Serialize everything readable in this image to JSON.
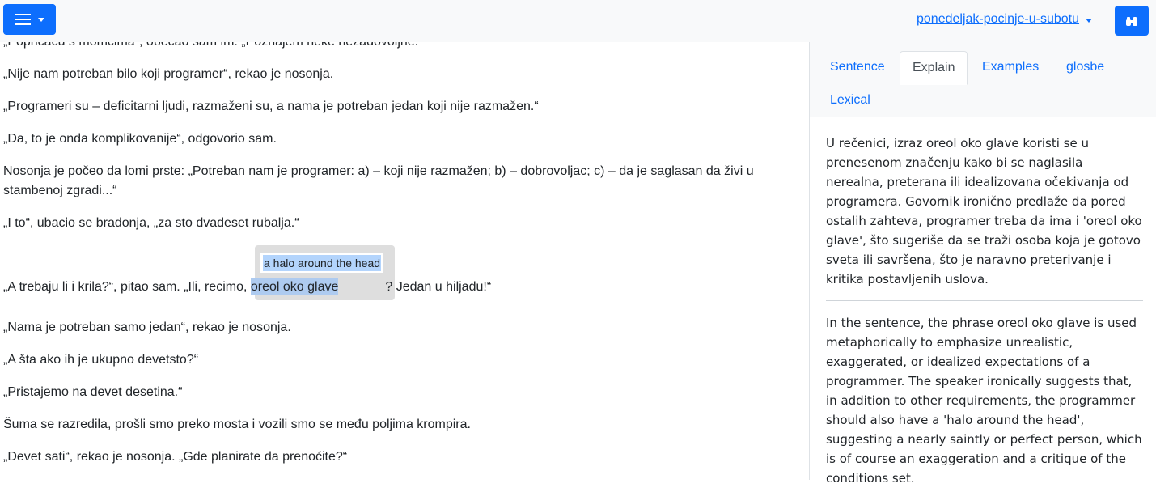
{
  "topbar": {
    "book_title": "ponedeljak-pocinje-u-subotu"
  },
  "reader": {
    "partial_line": "„Popričaću s momcima“, obećao sam im. „Poznajem neke nezadovoljne.“",
    "paragraphs": [
      "„Nije nam potreban bilo koji programer“, rekao je nosonja.",
      "„Programeri su – deficitarni ljudi, razmaženi su, a nama je potreban jedan koji nije razmažen.“",
      "„Da, to je onda komplikovanije“, odgovorio sam.",
      "Nosonja je počeo da lomi prste: „Potreban nam je programer: a) – koji nije razmažen; b) – dobrovoljac; c) – da je saglasan da živi u stambenoj zgradi...“",
      "„I to“, ubacio se bradonja, „za sto dvadeset rubalja.“"
    ],
    "selected_sentence": {
      "before": "„A trebaju li i krila?“, pitao sam. „Ili, recimo, ",
      "word": "oreol oko glave",
      "after": "? Jedan u hiljadu!“",
      "translation": "a halo around the head"
    },
    "paragraphs_after": [
      "„Nama je potreban samo jedan“, rekao je nosonja.",
      "„A šta ako ih je ukupno devetsto?“",
      "„Pristajemo na devet desetina.“",
      "Šuma se razredila, prošli smo preko mosta i vozili smo se među poljima krompira.",
      "„Devet sati“, rekao je nosonja. „Gde planirate da prenoćite?“"
    ]
  },
  "panel": {
    "tabs": [
      "Sentence",
      "Explain",
      "Examples",
      "glosbe",
      "Lexical"
    ],
    "active_tab": "Explain",
    "explain_native": "U rečenici, izraz oreol oko glave koristi se u prenesenom značenju kako bi se naglasila nerealna, preterana ili idealizovana očekivanja od programera. Govornik ironično predlaže da pored ostalih zahteva, programer treba da ima i 'oreol oko glave', što sugeriše da se traži osoba koja je gotovo sveta ili savršena, što je naravno preterivanje i kritika postavljenih uslova.",
    "explain_english": "In the sentence, the phrase oreol oko glave is used metaphorically to emphasize unrealistic, exaggerated, or idealized expectations of a programmer. The speaker ironically suggests that, in addition to other requirements, the programmer should also have a 'halo around the head', suggesting a nearly saintly or perfect person, which is of course an exaggeration and a critique of the conditions set."
  },
  "colors": {
    "primary": "#0d6efd",
    "highlight": "#aecbf0",
    "popup_bg": "#dedede"
  }
}
